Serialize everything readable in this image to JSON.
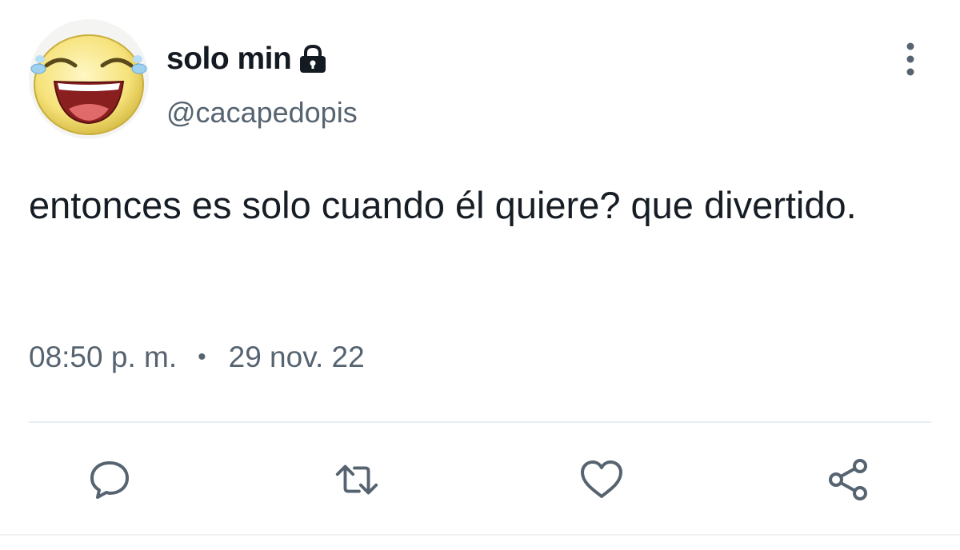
{
  "tweet": {
    "display_name": "solo min",
    "handle": "@cacapedopis",
    "text": "entonces es solo cuando él quiere? que divertido.",
    "time": "08:50 p. m.",
    "separator": "•",
    "date": "29 nov. 22"
  },
  "icons": {
    "avatar": "laughing-crying-emoji",
    "lock": "lock-icon",
    "more": "vertical-ellipsis-icon",
    "reply": "speech-bubble-icon",
    "retweet": "retweet-icon",
    "like": "heart-icon",
    "share": "share-icon"
  },
  "colors": {
    "text_primary": "#141b23",
    "text_secondary": "#566370",
    "icon": "#566370",
    "divider": "#e6ecf0"
  }
}
